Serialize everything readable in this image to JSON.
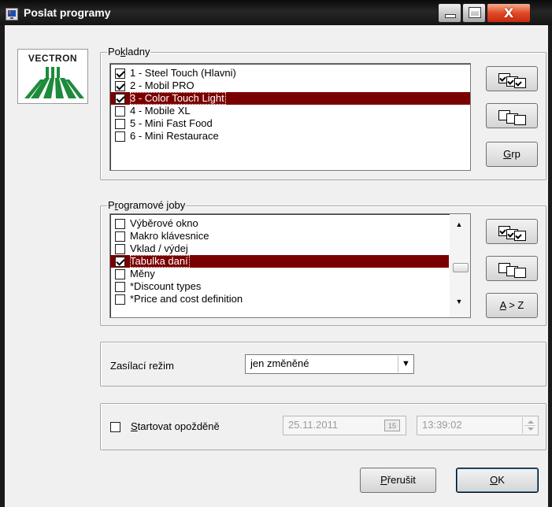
{
  "window": {
    "title": "Poslat programy",
    "close_glyph": "X"
  },
  "logo": {
    "text": "VECTRON",
    "color": "#1e8a3c"
  },
  "registers": {
    "title_pre": "Po",
    "title_acc": "k",
    "title_post": "ladny",
    "items": [
      {
        "label": "1 - Steel Touch (Hlavni)",
        "checked": true,
        "selected": false
      },
      {
        "label": "2 - Mobil PRO",
        "checked": true,
        "selected": false
      },
      {
        "label": "3 - Color Touch Light",
        "checked": true,
        "selected": true
      },
      {
        "label": "4 - Mobile XL",
        "checked": false,
        "selected": false
      },
      {
        "label": "5 - Mini Fast Food",
        "checked": false,
        "selected": false
      },
      {
        "label": "6 - Mini Restaurace",
        "checked": false,
        "selected": false
      }
    ],
    "buttons": {
      "select_all_icon": "check-all-icon",
      "deselect_all_icon": "uncheck-all-icon",
      "grp_acc": "G",
      "grp_rest": "rp"
    }
  },
  "jobs": {
    "title_pre": "P",
    "title_acc": "r",
    "title_post": "ogramové joby",
    "items": [
      {
        "label": "Výběrové okno",
        "checked": false,
        "selected": false
      },
      {
        "label": "Makro klávesnice",
        "checked": false,
        "selected": false
      },
      {
        "label": "Vklad / výdej",
        "checked": false,
        "selected": false
      },
      {
        "label": "Tabulka daní",
        "checked": true,
        "selected": true
      },
      {
        "label": "Měny",
        "checked": false,
        "selected": false
      },
      {
        "label": "*Discount types",
        "checked": false,
        "selected": false
      },
      {
        "label": "*Price and cost definition",
        "checked": false,
        "selected": false
      }
    ],
    "scroll": {
      "up": "▲",
      "down": "▼"
    },
    "buttons": {
      "sort_acc": "A",
      "sort_rest": " > Z"
    }
  },
  "send_mode": {
    "label": "Zasílací režim",
    "value": "jen změněné",
    "arrow": "▼"
  },
  "delayed_start": {
    "label_acc": "S",
    "label_rest": "tartovat opožděně",
    "checked": false,
    "date": "25.11.2011",
    "calendar_day": "15",
    "time": "13:39:02"
  },
  "footer": {
    "cancel_acc": "P",
    "cancel_rest": "řerušit",
    "ok_acc": "O",
    "ok_rest": "K"
  },
  "colors": {
    "selection": "#7a0000",
    "title_bar": "#141414"
  }
}
